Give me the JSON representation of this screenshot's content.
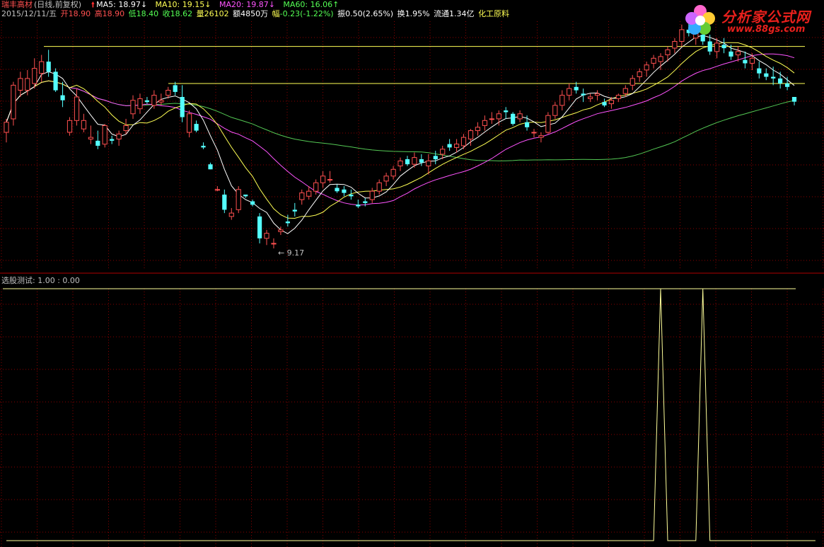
{
  "stock": {
    "name": "瑞丰高材",
    "mode": "(日线,前复权)",
    "date": "2015/12/11/五",
    "open_label": "开",
    "open": "18.90",
    "high_label": "高",
    "high": "18.90",
    "low_label": "低",
    "low": "18.40",
    "close_label": "收",
    "close": "18.62",
    "vol_label": "量",
    "vol": "26102",
    "amount_label": "额",
    "amount": "4850万",
    "change_label": "幅",
    "change": "-0.23(-1.22%)",
    "amplitude": "振0.50(2.65%)",
    "turnover": "换1.95%",
    "float": "流通1.34亿",
    "industry": "化工原料"
  },
  "ma_legend": {
    "ma5": "MA5: 18.97↓",
    "ma10": "MA10: 19.15↓",
    "ma20": "MA20: 19.87↓",
    "ma60": "MA60: 16.06↑"
  },
  "indicator": {
    "label": "选股测试",
    "value": ": 1.00 : 0.00"
  },
  "logo": {
    "text": "分析家公式网",
    "url": "www.88gs.com"
  },
  "colors": {
    "up": "#ff5050",
    "down": "#54ffff",
    "ma5": "#ffffff",
    "ma10": "#ffff54",
    "ma20": "#ff54ff",
    "ma60": "#54c854",
    "signal": "#ffff9a",
    "grid": "#8b0000",
    "level": "#ffff54"
  },
  "chart_data": {
    "type": "candlestick",
    "price_ylim": [
      8.6,
      23.4
    ],
    "indicator_ylim": [
      0,
      1
    ],
    "low_label": "9.17",
    "levels": [
      21.9,
      19.7
    ],
    "candles": [
      [
        16.8,
        17.6,
        16.2,
        17.4
      ],
      [
        17.6,
        19.8,
        17.2,
        19.6
      ],
      [
        19.3,
        20.4,
        18.9,
        20.0
      ],
      [
        19.3,
        20.5,
        19.0,
        20.0
      ],
      [
        19.7,
        21.2,
        19.4,
        20.6
      ],
      [
        20.3,
        21.4,
        19.8,
        21.0
      ],
      [
        21.0,
        21.7,
        20.1,
        20.4
      ],
      [
        20.4,
        20.6,
        19.2,
        19.3
      ],
      [
        19.0,
        19.8,
        18.3,
        18.7
      ],
      [
        16.8,
        17.7,
        16.6,
        17.5
      ],
      [
        17.5,
        19.4,
        17.2,
        18.9
      ],
      [
        17.0,
        17.9,
        16.8,
        17.5
      ],
      [
        16.4,
        17.2,
        16.1,
        16.5
      ],
      [
        16.3,
        16.9,
        15.8,
        16.0
      ],
      [
        16.1,
        17.3,
        15.9,
        17.2
      ],
      [
        16.4,
        16.6,
        16.1,
        16.3
      ],
      [
        16.4,
        16.9,
        16.0,
        16.7
      ],
      [
        16.9,
        17.6,
        16.7,
        17.2
      ],
      [
        17.9,
        19.0,
        17.6,
        18.7
      ],
      [
        18.2,
        19.1,
        17.9,
        18.8
      ],
      [
        18.7,
        18.9,
        18.5,
        18.6
      ],
      [
        18.4,
        19.3,
        18.2,
        19.0
      ],
      [
        18.6,
        19.1,
        18.4,
        18.7
      ],
      [
        19.0,
        19.5,
        18.8,
        19.3
      ],
      [
        19.6,
        19.8,
        19.0,
        19.2
      ],
      [
        18.9,
        19.6,
        17.4,
        17.7
      ],
      [
        16.8,
        18.1,
        16.5,
        17.9
      ],
      [
        17.3,
        17.5,
        16.8,
        16.9
      ],
      [
        16.0,
        16.2,
        15.8,
        15.9
      ],
      [
        14.9,
        15.0,
        14.6,
        14.6
      ],
      [
        13.4,
        13.6,
        13.3,
        13.4
      ],
      [
        13.1,
        13.4,
        12.0,
        12.2
      ],
      [
        11.8,
        12.3,
        11.6,
        12.0
      ],
      [
        12.2,
        13.6,
        12.0,
        13.4
      ],
      [
        13.1,
        13.1,
        12.9,
        13.0
      ],
      [
        12.7,
        12.8,
        12.4,
        12.5
      ],
      [
        11.8,
        12.0,
        10.2,
        10.5
      ],
      [
        10.5,
        11.0,
        10.1,
        10.8
      ],
      [
        10.2,
        10.5,
        9.9,
        10.2
      ],
      [
        10.9,
        11.2,
        10.7,
        11.0
      ],
      [
        11.5,
        11.9,
        11.2,
        11.4
      ],
      [
        12.2,
        12.6,
        11.8,
        12.1
      ],
      [
        12.8,
        13.4,
        12.5,
        13.2
      ],
      [
        13.0,
        13.6,
        12.8,
        13.3
      ],
      [
        13.3,
        14.0,
        13.1,
        13.8
      ],
      [
        13.8,
        14.5,
        13.5,
        14.2
      ],
      [
        14.0,
        14.5,
        13.8,
        14.0
      ],
      [
        13.5,
        13.7,
        13.2,
        13.3
      ],
      [
        13.4,
        13.6,
        13.0,
        13.2
      ],
      [
        13.1,
        13.4,
        12.8,
        13.0
      ],
      [
        12.5,
        12.8,
        12.3,
        12.4
      ],
      [
        12.7,
        12.9,
        12.4,
        12.6
      ],
      [
        12.8,
        13.5,
        12.6,
        13.3
      ],
      [
        13.3,
        14.0,
        13.1,
        13.8
      ],
      [
        13.9,
        14.4,
        13.6,
        14.2
      ],
      [
        14.2,
        14.8,
        14.0,
        14.6
      ],
      [
        14.8,
        15.3,
        14.5,
        15.1
      ],
      [
        15.2,
        15.4,
        14.8,
        14.9
      ],
      [
        14.9,
        15.6,
        14.7,
        15.3
      ],
      [
        15.2,
        15.5,
        14.8,
        15.0
      ],
      [
        14.8,
        15.5,
        14.3,
        15.1
      ],
      [
        15.4,
        15.7,
        14.9,
        15.2
      ],
      [
        15.5,
        16.0,
        15.2,
        15.8
      ],
      [
        16.1,
        16.4,
        15.7,
        15.9
      ],
      [
        15.9,
        16.4,
        15.6,
        16.1
      ],
      [
        16.0,
        16.7,
        15.8,
        16.5
      ],
      [
        16.4,
        17.0,
        16.0,
        16.9
      ],
      [
        16.9,
        17.4,
        16.6,
        17.1
      ],
      [
        17.2,
        17.8,
        16.9,
        17.5
      ],
      [
        17.6,
        18.0,
        17.3,
        17.6
      ],
      [
        17.6,
        18.1,
        17.2,
        17.9
      ],
      [
        18.1,
        18.3,
        17.6,
        18.0
      ],
      [
        17.9,
        18.0,
        17.2,
        17.3
      ],
      [
        17.6,
        18.1,
        17.4,
        17.9
      ],
      [
        17.4,
        17.8,
        16.9,
        17.1
      ],
      [
        16.8,
        17.0,
        16.5,
        16.8
      ],
      [
        16.5,
        16.8,
        16.2,
        16.6
      ],
      [
        16.8,
        18.0,
        16.7,
        17.8
      ],
      [
        17.8,
        18.6,
        17.6,
        18.4
      ],
      [
        18.4,
        19.3,
        18.1,
        19.0
      ],
      [
        19.0,
        19.7,
        18.7,
        19.4
      ],
      [
        19.5,
        19.8,
        19.1,
        19.3
      ],
      [
        19.1,
        19.4,
        18.6,
        19.0
      ],
      [
        18.8,
        19.1,
        18.6,
        18.9
      ],
      [
        19.0,
        19.3,
        18.7,
        19.1
      ],
      [
        18.6,
        18.8,
        18.3,
        18.4
      ],
      [
        18.5,
        18.9,
        18.2,
        18.7
      ],
      [
        18.8,
        19.1,
        18.6,
        19.0
      ],
      [
        19.1,
        19.6,
        18.9,
        19.4
      ],
      [
        19.6,
        20.2,
        19.3,
        20.0
      ],
      [
        20.1,
        20.6,
        19.8,
        20.4
      ],
      [
        20.5,
        21.0,
        20.1,
        20.8
      ],
      [
        20.9,
        21.4,
        20.6,
        21.2
      ],
      [
        21.0,
        21.5,
        20.5,
        21.3
      ],
      [
        21.4,
        21.9,
        21.0,
        21.7
      ],
      [
        21.8,
        22.4,
        21.5,
        22.2
      ],
      [
        22.2,
        23.2,
        21.9,
        22.9
      ],
      [
        22.9,
        23.3,
        22.5,
        22.7
      ],
      [
        22.4,
        23.1,
        22.0,
        22.8
      ],
      [
        22.6,
        22.8,
        22.0,
        22.2
      ],
      [
        22.2,
        22.6,
        21.4,
        21.6
      ],
      [
        21.6,
        22.4,
        21.2,
        22.1
      ],
      [
        22.0,
        22.4,
        21.5,
        21.8
      ],
      [
        21.6,
        22.0,
        21.1,
        21.3
      ],
      [
        21.4,
        21.9,
        21.0,
        21.6
      ],
      [
        21.1,
        21.6,
        20.6,
        20.9
      ],
      [
        20.9,
        21.5,
        20.5,
        21.2
      ],
      [
        20.6,
        21.0,
        20.0,
        20.3
      ],
      [
        20.3,
        20.6,
        19.9,
        20.1
      ],
      [
        20.1,
        20.7,
        19.6,
        20.0
      ],
      [
        20.0,
        20.4,
        19.4,
        19.7
      ],
      [
        19.7,
        20.1,
        19.3,
        19.5
      ],
      [
        18.9,
        18.9,
        18.4,
        18.62
      ]
    ],
    "signal_points": [
      0,
      0,
      0,
      0,
      0,
      0,
      0,
      0,
      0,
      0,
      0,
      0,
      0,
      0,
      0,
      0,
      0,
      0,
      0,
      0,
      0,
      0,
      0,
      0,
      0,
      0,
      0,
      0,
      0,
      0,
      0,
      0,
      0,
      0,
      0,
      0,
      0,
      0,
      0,
      0,
      0,
      0,
      0,
      0,
      0,
      0,
      0,
      0,
      0,
      0,
      0,
      0,
      0,
      0,
      0,
      0,
      0,
      0,
      0,
      0,
      0,
      0,
      0,
      0,
      0,
      0,
      0,
      0,
      0,
      0,
      0,
      0,
      0,
      0,
      0,
      0,
      0,
      0,
      0,
      0,
      0,
      0,
      0,
      0,
      0,
      0,
      0,
      0,
      0,
      0,
      0,
      0,
      0,
      1,
      0,
      0,
      0,
      0,
      0,
      1,
      0,
      0,
      0,
      0,
      0,
      0,
      0,
      0,
      0,
      0,
      0,
      0,
      0,
      0,
      0,
      0
    ]
  }
}
